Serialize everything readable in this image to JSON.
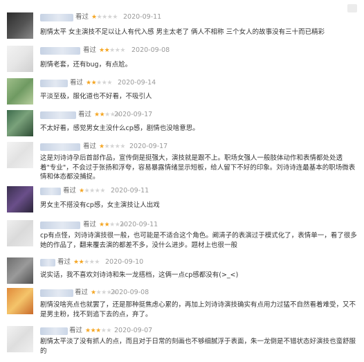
{
  "label_watched": "看过",
  "colors": {
    "star_on": "#f5a623",
    "star_off": "#d4d4d4",
    "date": "#999999"
  },
  "reviews": [
    {
      "rating": 1,
      "date": "2020-09-11",
      "content": "剧情太平 女主演技不足以让人有代入感 男主太老了 俩人不相称 三个女人的故事没有三十而已精彩"
    },
    {
      "rating": 2,
      "date": "2020-09-08",
      "content": "剧情老套，还有bug，有点尬。"
    },
    {
      "rating": 2,
      "date": "2020-09-14",
      "content": "平淡至极，服化道也不好看，不吸引人"
    },
    {
      "rating": 2,
      "date": "2020-09-17",
      "content": "不太好看，感觉男女主没什么cp感，剧情也没啥意思。"
    },
    {
      "rating": 1,
      "date": "2020-09-17",
      "content": "这是刘诗诗孕后首部作品，宣传倒是挺强大，演技就是跟不上。职场女强人一般肢体动作和表情都处处透着\"专业\"，不会过于张扬和浮夸，容易暴露情绪显示短板，给人留下不好的印象。刘诗诗连最基本的职场微表情和体态都没捕捉。"
    },
    {
      "rating": 1,
      "date": "2020-09-11",
      "content": "男女主不搭没有cp感，女主演技让人出戏"
    },
    {
      "rating": 2,
      "date": "2020-09-11",
      "content": "cp有点怪，刘诗诗演技很一般，也可能是不适合这个角色。阚清子的表演过于模式化了，表情单一，看了很多她的作品了，翻来覆去演的都差不多，没什么进步。题材上也很一般"
    },
    {
      "rating": 2,
      "date": "2020-09-10",
      "content": "说实话，我不喜欢刘诗诗和朱一龙搭档，这俩一点cp感都没有(>_<)"
    },
    {
      "rating": 1,
      "date": "2020-09-08",
      "content": "剧情没啥亮点也就罢了，还是那种挺焦虑心累的，再加上刘诗诗演技确实有点用力过猛不自然看着难受，又不是男主粉，找不到追下去的点，弃了。"
    },
    {
      "rating": 3,
      "date": "2020-09-07",
      "content": "剧情太平淡了没有抓人的点，而且对于日常的刻画也不够细腻浮于表面，朱一龙倒是不错状态好演技也蛮舒服的"
    }
  ]
}
